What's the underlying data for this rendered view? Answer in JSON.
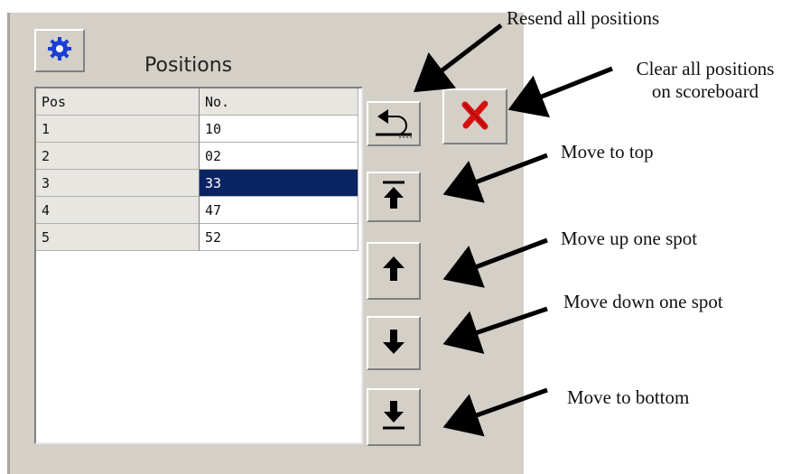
{
  "panel": {
    "title": "Positions",
    "gear_icon": "gear-icon",
    "columns": [
      "Pos",
      "No."
    ],
    "rows": [
      {
        "pos": "1",
        "no": "10"
      },
      {
        "pos": "2",
        "no": "02"
      },
      {
        "pos": "3",
        "no": "33",
        "selected": true
      },
      {
        "pos": "4",
        "no": "47"
      },
      {
        "pos": "5",
        "no": "52"
      }
    ]
  },
  "buttons": {
    "resend_icon": "undo-arrow-icon",
    "clear_icon": "red-x-icon",
    "top_icon": "arrow-to-top-icon",
    "up_icon": "arrow-up-icon",
    "down_icon": "arrow-down-icon",
    "bottom_icon": "arrow-to-bottom-icon"
  },
  "annotations": {
    "resend": "Resend all positions",
    "clear_line1": "Clear all positions",
    "clear_line2": "on scoreboard",
    "move_top": "Move to top",
    "move_up": "Move up one spot",
    "move_down": "Move down one spot",
    "move_bottom": "Move to bottom"
  },
  "colors": {
    "panel_bg": "#d4d0c8",
    "selection": "#0a2463",
    "gear": "#1a3fd6",
    "clear_x": "#d81010"
  }
}
